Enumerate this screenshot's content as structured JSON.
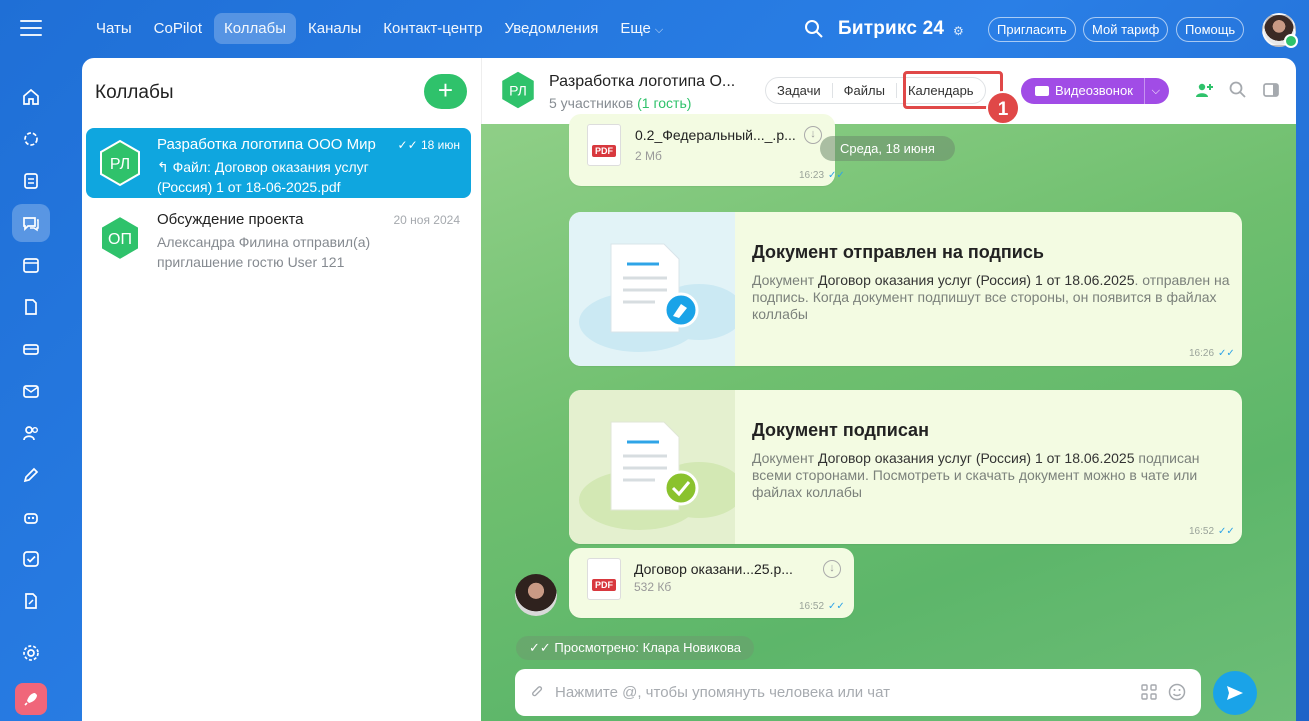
{
  "topbar": {
    "nav": [
      "Чаты",
      "CoPilot",
      "Коллабы",
      "Каналы",
      "Контакт-центр",
      "Уведомления",
      "Еще"
    ],
    "active_nav": "Коллабы",
    "brand": "Битрикс 24",
    "invite": "Пригласить",
    "tariff": "Мой тариф",
    "help": "Помощь"
  },
  "rail": {
    "icons": [
      "home-icon",
      "collab-icon",
      "feed-icon",
      "chat-icon",
      "calendar-icon",
      "docs-icon",
      "crm-icon",
      "mail-icon",
      "users-icon",
      "edit-icon",
      "robot-icon",
      "tasks-icon",
      "sign-icon",
      "settings-icon",
      "rocket-icon"
    ]
  },
  "list": {
    "title": "Коллабы",
    "items": [
      {
        "initials": "РЛ",
        "title": "Разработка логотипа ООО Мир",
        "date": "18 июн",
        "subtitle": "↰ Файл: Договор оказания услуг (Россия) 1 от 18-06-2025.pdf",
        "active": true
      },
      {
        "initials": "ОП",
        "title": "Обсуждение проекта",
        "date": "20 ноя 2024",
        "subtitle": "Александра Филина отправил(а) приглашение гостю User 121",
        "active": false
      }
    ]
  },
  "chat": {
    "initials": "РЛ",
    "title": "Разработка логотипа О...",
    "members": "5 участников",
    "guests": "(1 гость)",
    "tabs": [
      "Задачи",
      "Файлы",
      "Календарь"
    ],
    "step_badge": "1",
    "video_call": "Видеозвонок",
    "date_divider": "Среда, 18 июня",
    "file1": {
      "name": "0.2_Федеральный..._.p...",
      "size": "2 Мб",
      "time": "16:23",
      "type": "PDF"
    },
    "card1": {
      "title": "Документ отправлен на подпись",
      "text_pre": "Документ ",
      "text_doc": "Договор оказания услуг (Россия) 1 от 18.06.2025",
      "text_post": ". отправлен на подпись. Когда документ подпишут все стороны, он появится в файлах коллабы",
      "time": "16:26"
    },
    "card2": {
      "title": "Документ подписан",
      "text_pre": "Документ ",
      "text_doc": "Договор оказания услуг (Россия) 1 от 18.06.2025",
      "text_post": " подписан всеми сторонами. Посмотреть и скачать документ можно в чате или файлах коллабы",
      "time": "16:52"
    },
    "file2": {
      "name": "Договор оказани...25.p...",
      "size": "532 Кб",
      "time": "16:52",
      "type": "PDF"
    },
    "seen": "Просмотрено: Клара Новикова",
    "input_placeholder": "Нажмите @, чтобы упомянуть человека или чат"
  },
  "colors": {
    "accent_green": "#2fc26b",
    "active_item": "#0fa6df",
    "video_purple": "#a14ce6",
    "highlight_red": "#e04848",
    "send_blue": "#1aa3e8"
  }
}
